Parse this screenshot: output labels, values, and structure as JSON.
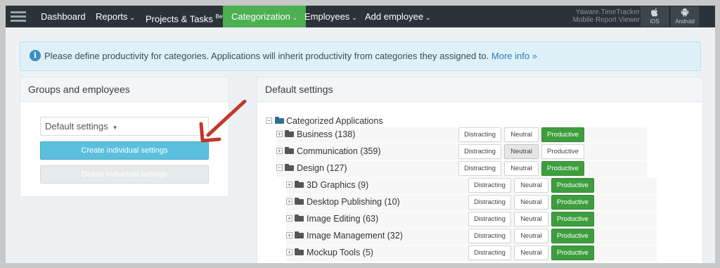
{
  "nav": {
    "items": [
      {
        "label": "Dashboard",
        "chevron": false
      },
      {
        "label": "Reports",
        "chevron": true
      },
      {
        "label": "Projects & Tasks",
        "sup": "Beta",
        "chevron": false
      },
      {
        "label": "Categorization",
        "chevron": true,
        "active": true
      },
      {
        "label": "Employees",
        "chevron": true
      },
      {
        "label": "Add employee",
        "chevron": true
      }
    ],
    "brand_line1": "Yaware.TimeTracker",
    "brand_line2": "Mobile Report Viewer",
    "ios_label": "iOS",
    "android_label": "Android",
    "chevron_glyph": "⌄"
  },
  "alert": {
    "text": "Please define productivity for categories. Applications will inherit productivity from categories they assigned to. ",
    "link": "More info »",
    "icon_glyph": "i"
  },
  "left_panel": {
    "title": "Groups and employees",
    "select_value": "Default settings",
    "create_label": "Create individual settings",
    "delete_label": "Delete individual settings"
  },
  "right_panel": {
    "title": "Default settings",
    "root_label": "Categorized Applications",
    "buttons": {
      "distracting": "Distracting",
      "neutral": "Neutral",
      "productive": "Productive"
    },
    "rows": [
      {
        "label": "Business (138)",
        "level": 0,
        "expanded": false,
        "selected": "productive"
      },
      {
        "label": "Communication (359)",
        "level": 0,
        "expanded": false,
        "selected": "neutral"
      },
      {
        "label": "Design (127)",
        "level": 0,
        "expanded": true,
        "selected": "productive"
      },
      {
        "label": "3D Graphics (9)",
        "level": 1,
        "expanded": false,
        "selected": "productive"
      },
      {
        "label": "Desktop Publishing (10)",
        "level": 1,
        "expanded": false,
        "selected": "productive"
      },
      {
        "label": "Image Editing (63)",
        "level": 1,
        "expanded": false,
        "selected": "productive"
      },
      {
        "label": "Image Management (32)",
        "level": 1,
        "expanded": false,
        "selected": "productive"
      },
      {
        "label": "Mockup Tools (5)",
        "level": 1,
        "expanded": false,
        "selected": "productive"
      }
    ]
  },
  "colors": {
    "nav_bg": "#2b3338",
    "active_green": "#4caf50",
    "productive_green": "#3e9e3e",
    "create_button": "#5bc0de",
    "alert_bg": "#dff1f8",
    "arrow_red": "#c0392b",
    "folder_root": "#2f6f8f",
    "folder": "#555555"
  },
  "icons": {
    "menu": "hamburger-icon",
    "ios": "apple-icon",
    "android": "android-icon",
    "info": "info-icon",
    "folder": "folder-icon",
    "expand": "plus-square-icon",
    "collapse": "minus-square-icon"
  }
}
